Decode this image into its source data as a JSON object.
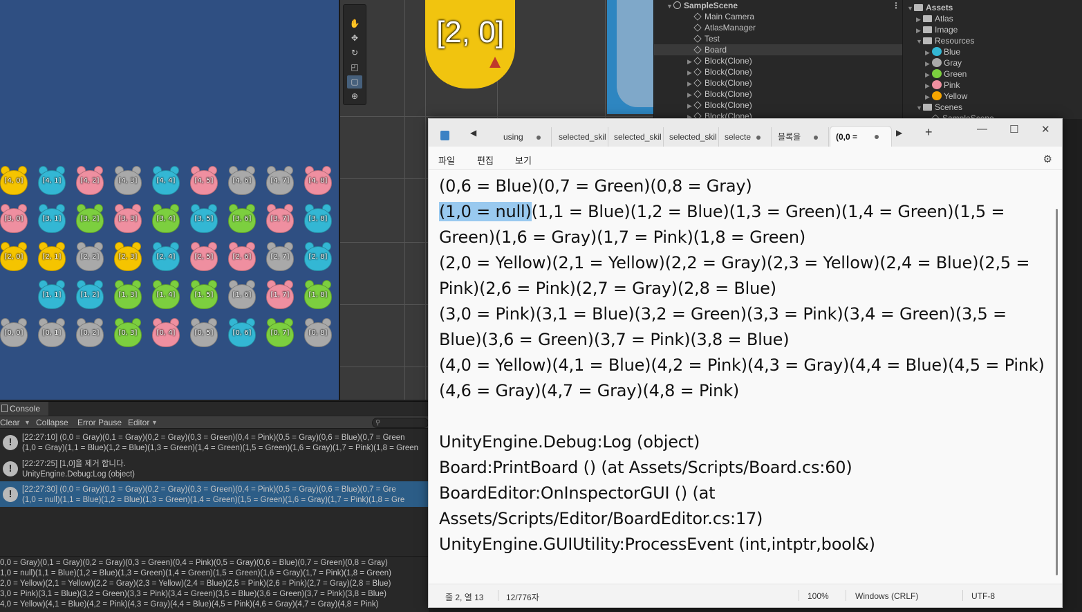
{
  "game_view": {
    "background": "#2f4f82",
    "rows": [
      {
        "cells": [
          {
            "label": "[4, 0]",
            "color": "Yellow"
          },
          {
            "label": "[4, 1]",
            "color": "Blue"
          },
          {
            "label": "[4, 2]",
            "color": "Pink"
          },
          {
            "label": "[4, 3]",
            "color": "Gray"
          },
          {
            "label": "[4, 4]",
            "color": "Blue"
          },
          {
            "label": "[4, 5]",
            "color": "Pink"
          },
          {
            "label": "[4, 6]",
            "color": "Gray"
          },
          {
            "label": "[4, 7]",
            "color": "Gray"
          },
          {
            "label": "[4, 8]",
            "color": "Pink"
          }
        ]
      },
      {
        "cells": [
          {
            "label": "[3, 0]",
            "color": "Pink"
          },
          {
            "label": "[3, 1]",
            "color": "Blue"
          },
          {
            "label": "[3, 2]",
            "color": "Green"
          },
          {
            "label": "[3, 3]",
            "color": "Pink"
          },
          {
            "label": "[3, 4]",
            "color": "Green"
          },
          {
            "label": "[3, 5]",
            "color": "Blue"
          },
          {
            "label": "[3, 6]",
            "color": "Green"
          },
          {
            "label": "[3, 7]",
            "color": "Pink"
          },
          {
            "label": "[3, 8]",
            "color": "Blue"
          }
        ]
      },
      {
        "cells": [
          {
            "label": "[2, 0]",
            "color": "Yellow"
          },
          {
            "label": "[2, 1]",
            "color": "Yellow"
          },
          {
            "label": "[2, 2]",
            "color": "Gray"
          },
          {
            "label": "[2, 3]",
            "color": "Yellow"
          },
          {
            "label": "[2, 4]",
            "color": "Blue"
          },
          {
            "label": "[2, 5]",
            "color": "Pink"
          },
          {
            "label": "[2, 6]",
            "color": "Pink"
          },
          {
            "label": "[2, 7]",
            "color": "Gray"
          },
          {
            "label": "[2, 8]",
            "color": "Blue"
          }
        ]
      },
      {
        "cells": [
          null,
          {
            "label": "[1, 1]",
            "color": "Blue"
          },
          {
            "label": "[1, 2]",
            "color": "Blue"
          },
          {
            "label": "[1, 3]",
            "color": "Green"
          },
          {
            "label": "[1, 4]",
            "color": "Green"
          },
          {
            "label": "[1, 5]",
            "color": "Green"
          },
          {
            "label": "[1, 6]",
            "color": "Gray"
          },
          {
            "label": "[1, 7]",
            "color": "Pink"
          },
          {
            "label": "[1, 8]",
            "color": "Green"
          }
        ]
      },
      {
        "cells": [
          {
            "label": "[0, 0]",
            "color": "Gray"
          },
          {
            "label": "[0, 1]",
            "color": "Gray"
          },
          {
            "label": "[0, 2]",
            "color": "Gray"
          },
          {
            "label": "[0, 3]",
            "color": "Green"
          },
          {
            "label": "[0, 4]",
            "color": "Pink"
          },
          {
            "label": "[0, 5]",
            "color": "Gray"
          },
          {
            "label": "[0, 6]",
            "color": "Blue"
          },
          {
            "label": "[0, 7]",
            "color": "Green"
          },
          {
            "label": "[0, 8]",
            "color": "Gray"
          }
        ]
      }
    ],
    "palette": {
      "Yellow": "#f5c400",
      "Blue": "#33b7d4",
      "Pink": "#ef8fa0",
      "Gray": "#a9a9a9",
      "Green": "#7ccf3f"
    }
  },
  "scene_view": {
    "big_block_label": "[2, 0]",
    "tools": [
      "hand-tool",
      "move-tool",
      "rotate-tool",
      "scale-tool",
      "rect-tool",
      "transform-tool"
    ],
    "active_tool": "rect-tool"
  },
  "hierarchy": {
    "scene_name": "SampleScene",
    "items": [
      {
        "name": "Main Camera",
        "expandable": false,
        "selected": false
      },
      {
        "name": "AtlasManager",
        "expandable": false,
        "selected": false
      },
      {
        "name": "Test",
        "expandable": false,
        "selected": false
      },
      {
        "name": "Board",
        "expandable": false,
        "selected": true
      },
      {
        "name": "Block(Clone)",
        "expandable": true,
        "selected": false
      },
      {
        "name": "Block(Clone)",
        "expandable": true,
        "selected": false
      },
      {
        "name": "Block(Clone)",
        "expandable": true,
        "selected": false
      },
      {
        "name": "Block(Clone)",
        "expandable": true,
        "selected": false
      },
      {
        "name": "Block(Clone)",
        "expandable": true,
        "selected": false
      },
      {
        "name": "Block(Clone)",
        "expandable": true,
        "selected": false
      }
    ]
  },
  "project": {
    "root": "Assets",
    "items": [
      {
        "name": "Atlas",
        "kind": "folder",
        "depth": 1,
        "open": false
      },
      {
        "name": "Image",
        "kind": "folder",
        "depth": 1,
        "open": false
      },
      {
        "name": "Resources",
        "kind": "folder",
        "depth": 1,
        "open": true
      },
      {
        "name": "Blue",
        "kind": "sprite",
        "depth": 2,
        "color": "#33b7d4"
      },
      {
        "name": "Gray",
        "kind": "sprite",
        "depth": 2,
        "color": "#a9a9a9"
      },
      {
        "name": "Green",
        "kind": "sprite",
        "depth": 2,
        "color": "#7ccf3f"
      },
      {
        "name": "Pink",
        "kind": "sprite",
        "depth": 2,
        "color": "#ef8fa0"
      },
      {
        "name": "Yellow",
        "kind": "sprite",
        "depth": 2,
        "color": "#f5a500"
      },
      {
        "name": "Scenes",
        "kind": "folder",
        "depth": 1,
        "open": true
      },
      {
        "name": "SampleScene",
        "kind": "scene",
        "depth": 2
      }
    ]
  },
  "console": {
    "tab_label": "Console",
    "toolbar": {
      "clear": "Clear",
      "collapse": "Collapse",
      "error_pause": "Error Pause",
      "editor": "Editor"
    },
    "logs": [
      {
        "line1": "[22:27:10] (0,0 = Gray)(0,1 = Gray)(0,2 = Gray)(0,3 = Green)(0,4 = Pink)(0,5 = Gray)(0,6 = Blue)(0,7 = Green",
        "line2": "(1,0 = Gray)(1,1 = Blue)(1,2 = Blue)(1,3 = Green)(1,4 = Green)(1,5 = Green)(1,6 = Gray)(1,7 = Pink)(1,8 = Green",
        "selected": false
      },
      {
        "line1": "[22:27:25] [1,0]을 제거 합니다.",
        "line2": "UnityEngine.Debug:Log (object)",
        "selected": false
      },
      {
        "line1": "[22:27:30] (0,0 = Gray)(0,1 = Gray)(0,2 = Gray)(0,3 = Green)(0,4 = Pink)(0,5 = Gray)(0,6 = Blue)(0,7 = Gre",
        "line2": "(1,0 = null)(1,1 = Blue)(1,2 = Blue)(1,3 = Green)(1,4 = Green)(1,5 = Green)(1,6 = Gray)(1,7 = Pink)(1,8 = Gre",
        "selected": true
      }
    ],
    "detail": [
      "0,0 = Gray)(0,1 = Gray)(0,2 = Gray)(0,3 = Green)(0,4 = Pink)(0,5 = Gray)(0,6 = Blue)(0,7 = Green)(0,8 = Gray)",
      "1,0 = null)(1,1 = Blue)(1,2 = Blue)(1,3 = Green)(1,4 = Green)(1,5 = Green)(1,6 = Gray)(1,7 = Pink)(1,8 = Green)",
      "2,0 = Yellow)(2,1 = Yellow)(2,2 = Gray)(2,3 = Yellow)(2,4 = Blue)(2,5 = Pink)(2,6 = Pink)(2,7 = Gray)(2,8 = Blue)",
      "3,0 = Pink)(3,1 = Blue)(3,2 = Green)(3,3 = Pink)(3,4 = Green)(3,5 = Blue)(3,6 = Green)(3,7 = Pink)(3,8 = Blue)",
      "4,0 = Yellow)(4,1 = Blue)(4,2 = Pink)(4,3 = Gray)(4,4 = Blue)(4,5 = Pink)(4,6 = Gray)(4,7 = Gray)(4,8 = Pink)"
    ]
  },
  "notepad": {
    "tabs": [
      "using ",
      "selected_skil",
      "selected_skil",
      "selected_skil",
      "selecte",
      "블록을",
      "(0,0 ="
    ],
    "menu": {
      "file": "파일",
      "edit": "편집",
      "view": "보기"
    },
    "lines": [
      {
        "pre": "(0,6 = Blue)(0,7 = Green)(0,8 = Gray)",
        "hl": "",
        "post": ""
      },
      {
        "pre": "",
        "hl": "(1,0 = null)",
        "post": "(1,1 = Blue)(1,2 = Blue)(1,3 = Green)(1,4 = Green)(1,5 ="
      },
      {
        "pre": "Green)(1,6 = Gray)(1,7 = Pink)(1,8 = Green)",
        "hl": "",
        "post": ""
      },
      {
        "pre": "(2,0 = Yellow)(2,1 = Yellow)(2,2 = Gray)(2,3 = Yellow)(2,4 = Blue)(2,5 =",
        "hl": "",
        "post": ""
      },
      {
        "pre": "Pink)(2,6 = Pink)(2,7 = Gray)(2,8 = Blue)",
        "hl": "",
        "post": ""
      },
      {
        "pre": "(3,0 = Pink)(3,1 = Blue)(3,2 = Green)(3,3 = Pink)(3,4 = Green)(3,5 =",
        "hl": "",
        "post": ""
      },
      {
        "pre": "Blue)(3,6 = Green)(3,7 = Pink)(3,8 = Blue)",
        "hl": "",
        "post": ""
      },
      {
        "pre": "(4,0 = Yellow)(4,1 = Blue)(4,2 = Pink)(4,3 = Gray)(4,4 = Blue)(4,5 = Pink)",
        "hl": "",
        "post": ""
      },
      {
        "pre": "(4,6 = Gray)(4,7 = Gray)(4,8 = Pink)",
        "hl": "",
        "post": ""
      },
      {
        "pre": "",
        "hl": "",
        "post": ""
      },
      {
        "pre": "UnityEngine.Debug:Log (object)",
        "hl": "",
        "post": ""
      },
      {
        "pre": "Board:PrintBoard () (at Assets/Scripts/Board.cs:60)",
        "hl": "",
        "post": ""
      },
      {
        "pre": "BoardEditor:OnInspectorGUI () (at",
        "hl": "",
        "post": ""
      },
      {
        "pre": "Assets/Scripts/Editor/BoardEditor.cs:17)",
        "hl": "",
        "post": ""
      },
      {
        "pre": "UnityEngine.GUIUtility:ProcessEvent (int,intptr,bool&)",
        "hl": "",
        "post": ""
      }
    ],
    "status": {
      "position": "줄 2, 열 13",
      "chars": "12/776자",
      "zoom": "100%",
      "eol": "Windows (CRLF)",
      "encoding": "UTF-8"
    }
  }
}
